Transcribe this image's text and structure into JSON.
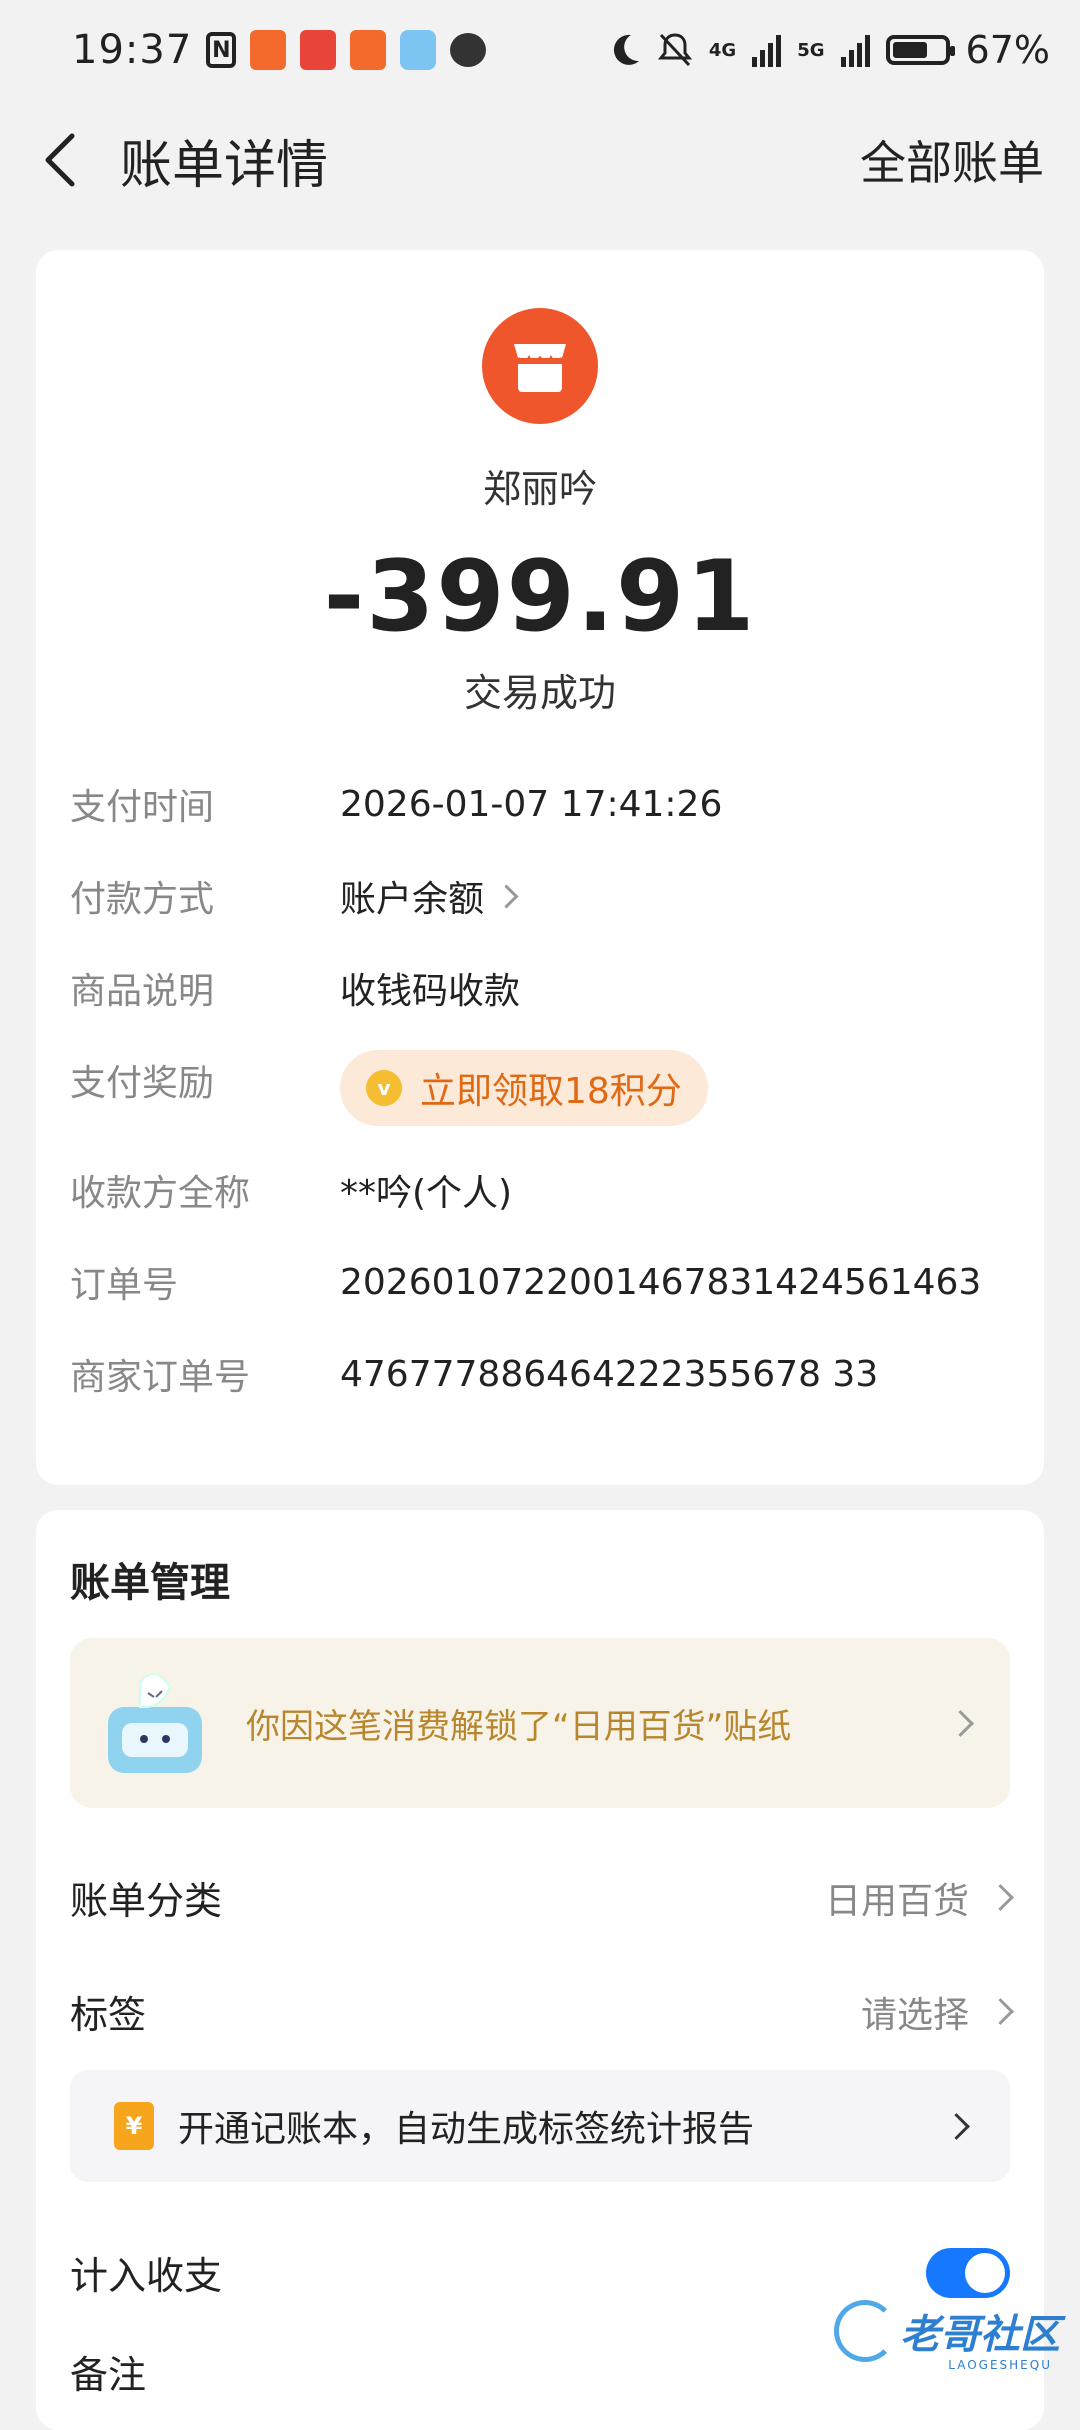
{
  "status_bar": {
    "time": "19:37",
    "battery_percent": "67%",
    "battery_level": 0.67,
    "network_1": "4G",
    "network_2": "5G"
  },
  "nav": {
    "title": "账单详情",
    "right_link": "全部账单"
  },
  "bill": {
    "merchant_name": "郑丽吟",
    "amount": "-399.91",
    "status": "交易成功",
    "details": [
      {
        "key": "支付时间",
        "value": "2026-01-07 17:41:26"
      },
      {
        "key": "付款方式",
        "value": "账户余额"
      },
      {
        "key": "商品说明",
        "value": "收钱码收款"
      },
      {
        "key": "支付奖励",
        "value": "立即领取18积分"
      },
      {
        "key": "收款方全称",
        "value": "**吟(个人)"
      },
      {
        "key": "订单号",
        "value": "2026010722001467831424561463"
      },
      {
        "key": "商家订单号",
        "value": "476777886464222355678 33"
      }
    ]
  },
  "management": {
    "title": "账单管理",
    "sticker_text": "你因这笔消费解锁了“日用百货”贴纸",
    "category_label": "账单分类",
    "category_value": "日用百货",
    "tag_label": "标签",
    "tag_value": "请选择",
    "ledger_text": "开通记账本，自动生成标签统计报告",
    "ledger_icon_glyph": "¥",
    "include_label": "计入收支",
    "include_enabled": true,
    "note_label": "备注"
  },
  "watermark": {
    "text": "老哥社区",
    "sub": "LAOGESHEQU"
  },
  "colors": {
    "accent": "#1677ff",
    "merchant_icon": "#f0562b",
    "reward_text": "#e06a14",
    "sticker_text": "#b8862c"
  }
}
